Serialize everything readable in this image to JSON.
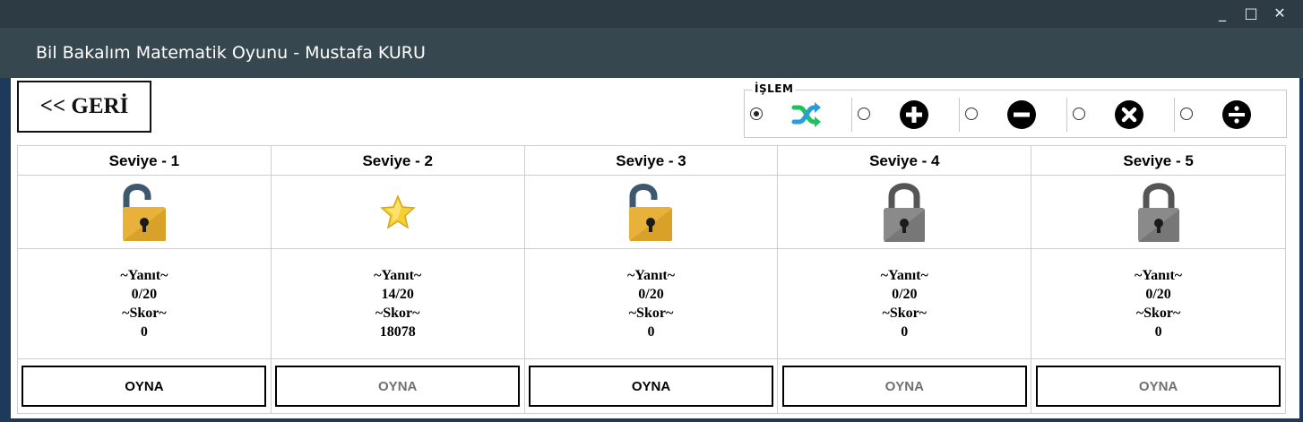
{
  "window": {
    "title": "Bil Bakalım Matematik Oyunu - Mustafa KURU",
    "controls": {
      "minimize": "_",
      "maximize": "□",
      "close": "✕"
    }
  },
  "back_button": {
    "label": "<< GERİ"
  },
  "operation_group": {
    "legend": "İŞLEM",
    "selected": "random",
    "options": [
      {
        "id": "random",
        "icon": "shuffle-icon",
        "checked": true
      },
      {
        "id": "add",
        "icon": "plus-icon",
        "checked": false
      },
      {
        "id": "subtract",
        "icon": "minus-icon",
        "checked": false
      },
      {
        "id": "multiply",
        "icon": "times-icon",
        "checked": false
      },
      {
        "id": "divide",
        "icon": "divide-icon",
        "checked": false
      }
    ]
  },
  "levels": [
    {
      "title": "Seviye - 1",
      "icon": "unlocked-padlock-icon",
      "answer_label": "~Yanıt~",
      "answer": "0/20",
      "score_label": "~Skor~",
      "score": "0",
      "play_label": "OYNA",
      "play_enabled": true
    },
    {
      "title": "Seviye - 2",
      "icon": "star-icon",
      "answer_label": "~Yanıt~",
      "answer": "14/20",
      "score_label": "~Skor~",
      "score": "18078",
      "play_label": "OYNA",
      "play_enabled": false
    },
    {
      "title": "Seviye - 3",
      "icon": "unlocked-padlock-icon",
      "answer_label": "~Yanıt~",
      "answer": "0/20",
      "score_label": "~Skor~",
      "score": "0",
      "play_label": "OYNA",
      "play_enabled": true
    },
    {
      "title": "Seviye - 4",
      "icon": "locked-padlock-icon",
      "answer_label": "~Yanıt~",
      "answer": "0/20",
      "score_label": "~Skor~",
      "score": "0",
      "play_label": "OYNA",
      "play_enabled": false
    },
    {
      "title": "Seviye - 5",
      "icon": "locked-padlock-icon",
      "answer_label": "~Yanıt~",
      "answer": "0/20",
      "score_label": "~Skor~",
      "score": "0",
      "play_label": "OYNA",
      "play_enabled": false
    }
  ],
  "colors": {
    "title_bar": "#37474f",
    "unlocked_padlock": "#e8b23a",
    "locked_padlock": "#8a8a8a",
    "star": "#f5d033",
    "play_enabled_text": "#000000",
    "play_disabled_text": "#707070"
  }
}
